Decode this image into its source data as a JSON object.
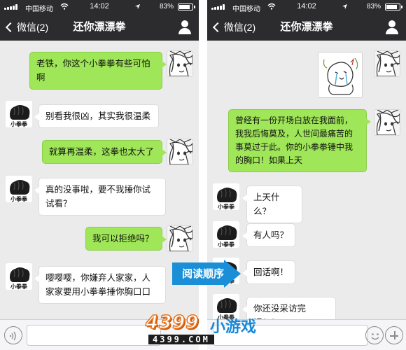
{
  "status_bar": {
    "carrier": "中国移动",
    "time": "14:02",
    "battery": "83%",
    "wifi_icon": "wifi-icon",
    "location_icon": "location-arrow-icon",
    "battery_icon": "battery-icon"
  },
  "nav": {
    "back_label": "微信(2)",
    "title": "还你漂漂拳",
    "profile_icon": "person-icon"
  },
  "left_chat": [
    {
      "from": "me",
      "text": "老铁，你这个小拳拳有些可怕啊"
    },
    {
      "from": "them",
      "text": "别看我很凶，其实我很温柔"
    },
    {
      "from": "me",
      "text": "就算再温柔，这拳也太大了"
    },
    {
      "from": "them",
      "text": "真的没事啦，要不我捶你试试看？"
    },
    {
      "from": "me",
      "text": "我可以拒绝吗？"
    },
    {
      "from": "them",
      "text": "嘤嘤嘤，你嫌弃人家家，人家家要用小拳拳捶你胸口口"
    }
  ],
  "right_chat": [
    {
      "from": "me",
      "type": "sticker",
      "sticker_icon": "crying-doodle-sticker"
    },
    {
      "from": "me",
      "text": "曾经有一份开场白放在我面前，我我后悔莫及，人世间最痛苦的事莫过于此。你的小拳拳锤中我的胸口！如果上天"
    },
    {
      "from": "them",
      "text": "上天什么？"
    },
    {
      "from": "them",
      "text": "有人吗？"
    },
    {
      "from": "them",
      "text": "回话啊！"
    },
    {
      "from": "them",
      "text": "你还没采访完呢！！"
    }
  ],
  "avatars": {
    "me": "girl-sketch-avatar",
    "them": "black-fist-avatar",
    "them_caption": "小拳拳"
  },
  "input_bar": {
    "voice_icon": "voice-icon",
    "emoji_icon": "emoji-icon",
    "plus_icon": "plus-icon"
  },
  "overlay": {
    "arrow_label": "阅读顺序",
    "arrow_color": "#1a8fd8",
    "brand_number": "4399",
    "brand_text": "小游戏",
    "brand_url": "4399.COM"
  },
  "colors": {
    "bar_dark": "#2c2c2e",
    "chat_bg": "#ebebeb",
    "bubble_me": "#9fe658",
    "bubble_them": "#ffffff"
  }
}
